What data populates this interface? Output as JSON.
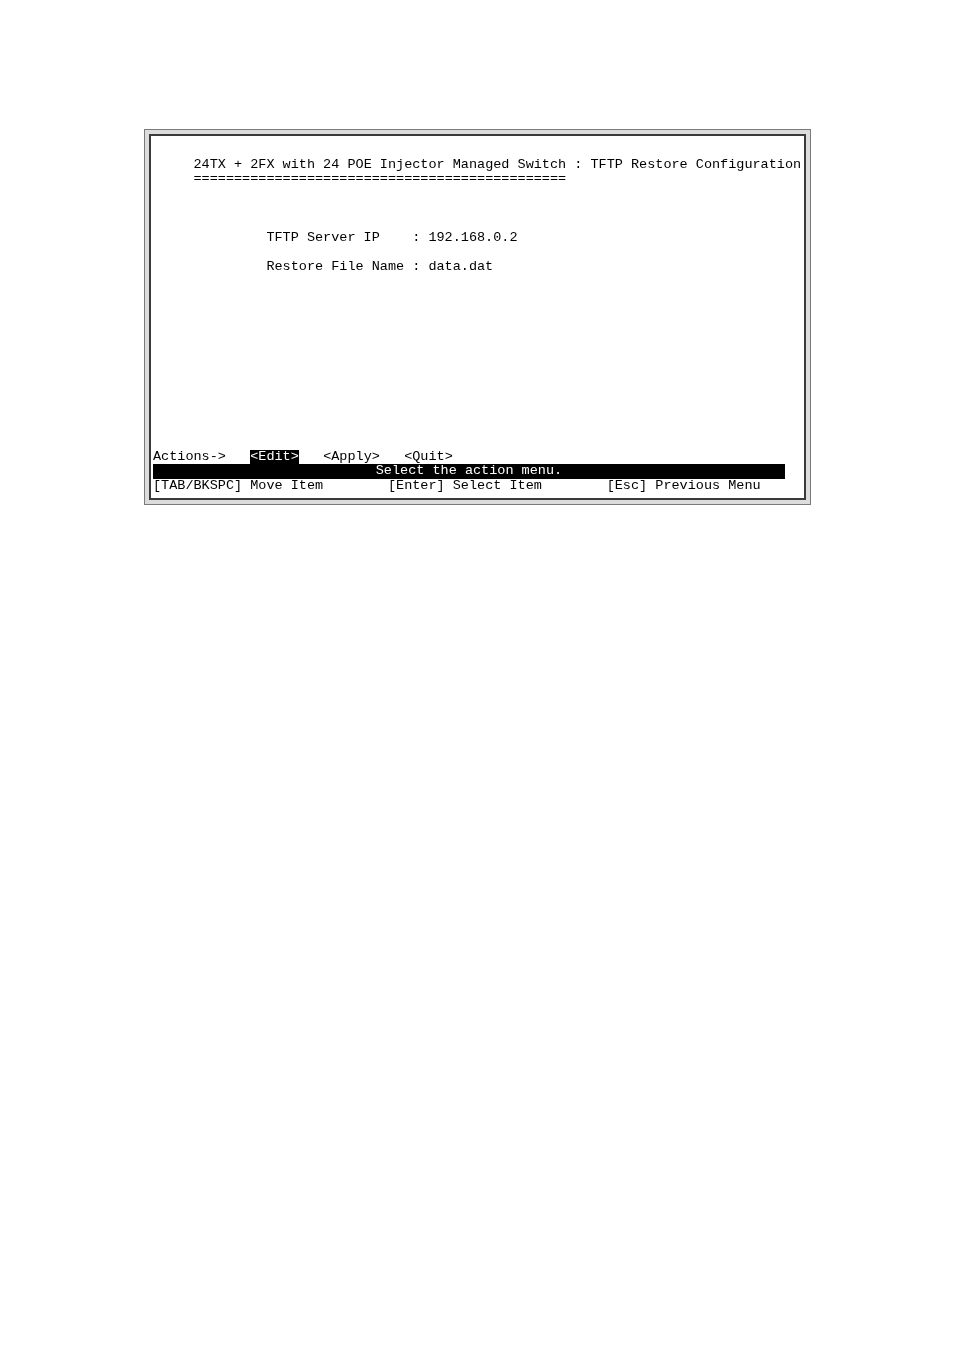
{
  "window": {
    "title": "24TX + 2FX with 24 POE Injector Managed Switch : TFTP Restore Configuration",
    "title_underline": "=============================================="
  },
  "fields": [
    {
      "label": "TFTP Server IP",
      "separator": ":",
      "value": "192.168.0.2"
    },
    {
      "label": "Restore File Name",
      "separator": ":",
      "value": "data.dat"
    }
  ],
  "actions": {
    "label": "Actions->",
    "items": [
      {
        "label": "<Edit>",
        "selected": true
      },
      {
        "label": "<Apply>",
        "selected": false
      },
      {
        "label": "<Quit>",
        "selected": false
      }
    ]
  },
  "status_bar": {
    "message": "Select the action menu."
  },
  "help": [
    "[TAB/BKSPC] Move Item",
    "[Enter] Select Item",
    "[Esc] Previous Menu"
  ]
}
